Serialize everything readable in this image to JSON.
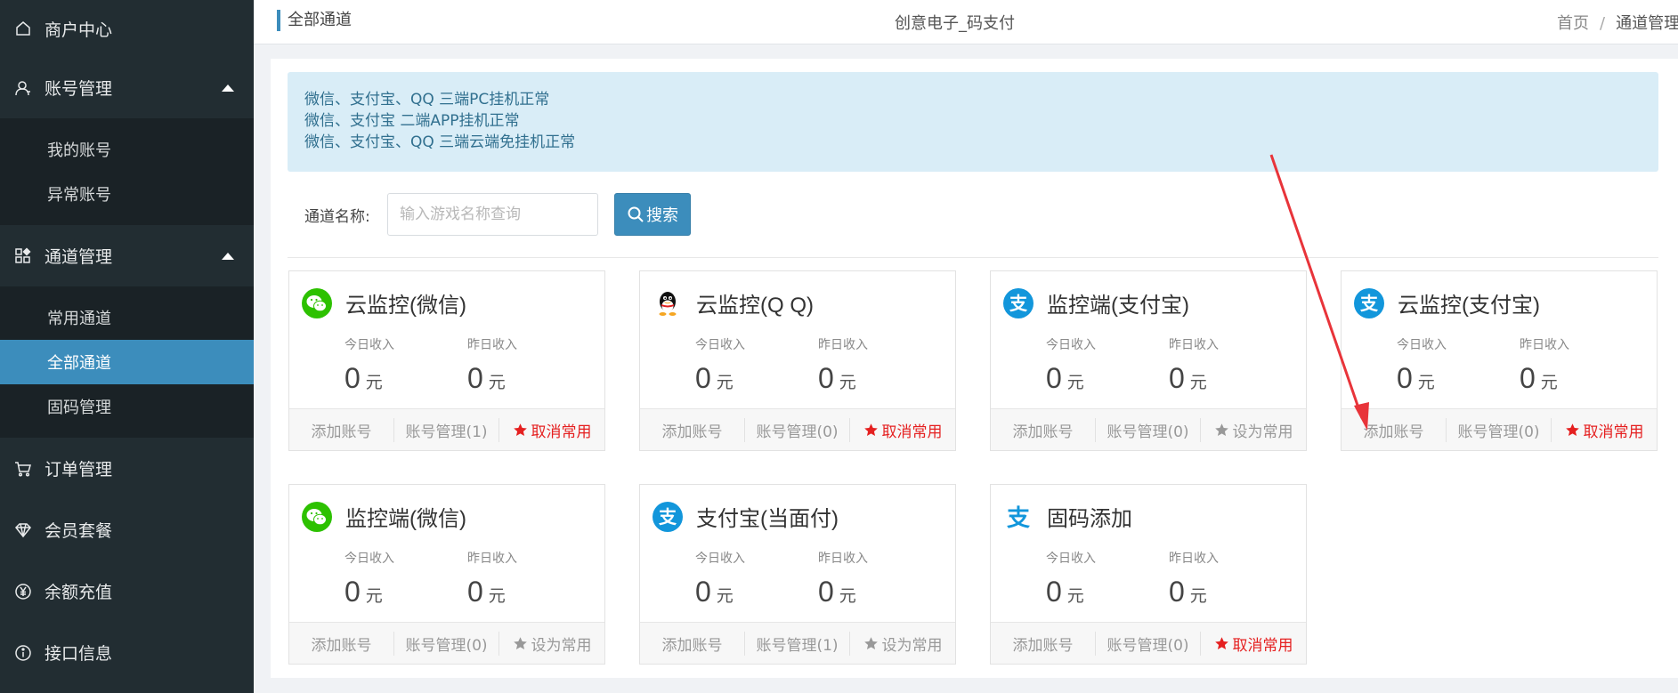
{
  "sidebar": {
    "merchant_center": "商户中心",
    "account_mgmt": "账号管理",
    "my_account": "我的账号",
    "abnormal_account": "异常账号",
    "channel_mgmt": "通道管理",
    "common_channel": "常用通道",
    "all_channel": "全部通道",
    "fixed_code_mgmt": "固码管理",
    "order_mgmt": "订单管理",
    "member_package": "会员套餐",
    "balance_recharge": "余额充值",
    "api_info": "接口信息"
  },
  "topbar": {
    "title": "全部通道",
    "center_title": "创意电子_码支付",
    "breadcrumb_home": "首页",
    "breadcrumb_sep": "/",
    "breadcrumb_current": "通道管理"
  },
  "notice": {
    "line1": "微信、支付宝、QQ 三端PC挂机正常",
    "line2": "微信、支付宝 二端APP挂机正常",
    "line3": "微信、支付宝、QQ 三端云端免挂机正常"
  },
  "search": {
    "label": "通道名称:",
    "placeholder": "输入游戏名称查询",
    "button": "搜索"
  },
  "colors": {
    "sidebar_bg": "#222d32",
    "accent": "#3c8dbc",
    "active_red": "#e52020"
  },
  "cards": [
    {
      "title": "云监控(微信)",
      "icon": "wechat-icon",
      "today_label": "今日收入",
      "today": "0",
      "yesterday_label": "昨日收入",
      "yesterday": "0",
      "unit": "元",
      "add": "添加账号",
      "manage": "账号管理(1)",
      "favorite": "取消常用",
      "favorite_active": true
    },
    {
      "title": "云监控(Q Q)",
      "icon": "qq-icon",
      "today_label": "今日收入",
      "today": "0",
      "yesterday_label": "昨日收入",
      "yesterday": "0",
      "unit": "元",
      "add": "添加账号",
      "manage": "账号管理(0)",
      "favorite": "取消常用",
      "favorite_active": true
    },
    {
      "title": "监控端(支付宝)",
      "icon": "alipay-icon",
      "today_label": "今日收入",
      "today": "0",
      "yesterday_label": "昨日收入",
      "yesterday": "0",
      "unit": "元",
      "add": "添加账号",
      "manage": "账号管理(0)",
      "favorite": "设为常用",
      "favorite_active": false
    },
    {
      "title": "云监控(支付宝)",
      "icon": "alipay-icon",
      "today_label": "今日收入",
      "today": "0",
      "yesterday_label": "昨日收入",
      "yesterday": "0",
      "unit": "元",
      "add": "添加账号",
      "manage": "账号管理(0)",
      "favorite": "取消常用",
      "favorite_active": true
    },
    {
      "title": "监控端(微信)",
      "icon": "wechat-icon",
      "today_label": "今日收入",
      "today": "0",
      "yesterday_label": "昨日收入",
      "yesterday": "0",
      "unit": "元",
      "add": "添加账号",
      "manage": "账号管理(0)",
      "favorite": "设为常用",
      "favorite_active": false
    },
    {
      "title": "支付宝(当面付)",
      "icon": "alipay-icon",
      "today_label": "今日收入",
      "today": "0",
      "yesterday_label": "昨日收入",
      "yesterday": "0",
      "unit": "元",
      "add": "添加账号",
      "manage": "账号管理(1)",
      "favorite": "设为常用",
      "favorite_active": false
    },
    {
      "title": "固码添加",
      "icon": "alipay-char-icon",
      "today_label": "今日收入",
      "today": "0",
      "yesterday_label": "昨日收入",
      "yesterday": "0",
      "unit": "元",
      "add": "添加账号",
      "manage": "账号管理(0)",
      "favorite": "取消常用",
      "favorite_active": true
    }
  ]
}
